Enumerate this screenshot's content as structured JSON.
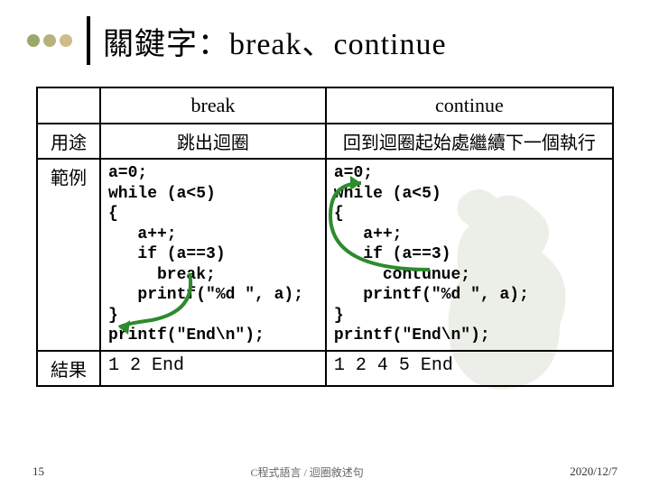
{
  "title": "關鍵字：break、continue",
  "dots": [
    "#9aa86a",
    "#b8b27a",
    "#cdbd8b"
  ],
  "table": {
    "headers": [
      "break",
      "continue"
    ],
    "rowlabels": {
      "usage": "用途",
      "example": "範例",
      "result": "結果"
    },
    "usage": {
      "break": "跳出迴圈",
      "continue": "回到迴圈起始處繼續下一個執行"
    },
    "code": {
      "break": "a=0;\nwhile (a<5)\n{\n   a++;\n   if (a==3)\n     break;\n   printf(\"%d \", a);\n}\nprintf(\"End\\n\");",
      "continue": "a=0;\nwhile (a<5)\n{\n   a++;\n   if (a==3)\n     contunue;\n   printf(\"%d \", a);\n}\nprintf(\"End\\n\");"
    },
    "result": {
      "break": "1 2 End",
      "continue": "1 2 4 5 End"
    }
  },
  "footer": {
    "page": "15",
    "mid": "C程式語言 / 迴圈敘述句",
    "date": "2020/12/7"
  }
}
